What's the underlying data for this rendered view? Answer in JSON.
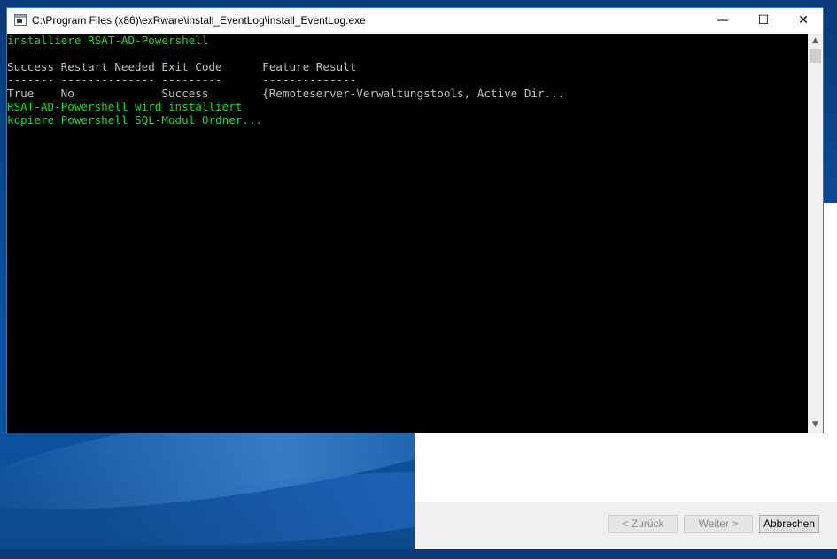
{
  "console": {
    "title": "C:\\Program Files (x86)\\exRware\\install_EventLog\\install_EventLog.exe",
    "minimize_glyph": "—",
    "maximize_glyph": "☐",
    "close_glyph": "✕",
    "lines": [
      {
        "text": "installiere RSAT-AD-Powershell",
        "color": "green"
      },
      {
        "text": "",
        "color": "gray"
      },
      {
        "text": "Success Restart Needed Exit Code      Feature Result",
        "color": "gray"
      },
      {
        "text": "------- -------------- ---------      --------------",
        "color": "gray"
      },
      {
        "text": "True    No             Success        {Remoteserver-Verwaltungstools, Active Dir...",
        "color": "gray"
      },
      {
        "text": "RSAT-AD-Powershell wird installiert",
        "color": "green"
      },
      {
        "text": "kopiere Powershell SQL-Modul Ordner...",
        "color": "green"
      }
    ],
    "scroll_up": "▲",
    "scroll_down": "▼"
  },
  "installer": {
    "back_label": "< Zurück",
    "next_label": "Weiter >",
    "cancel_label": "Abbrechen"
  }
}
